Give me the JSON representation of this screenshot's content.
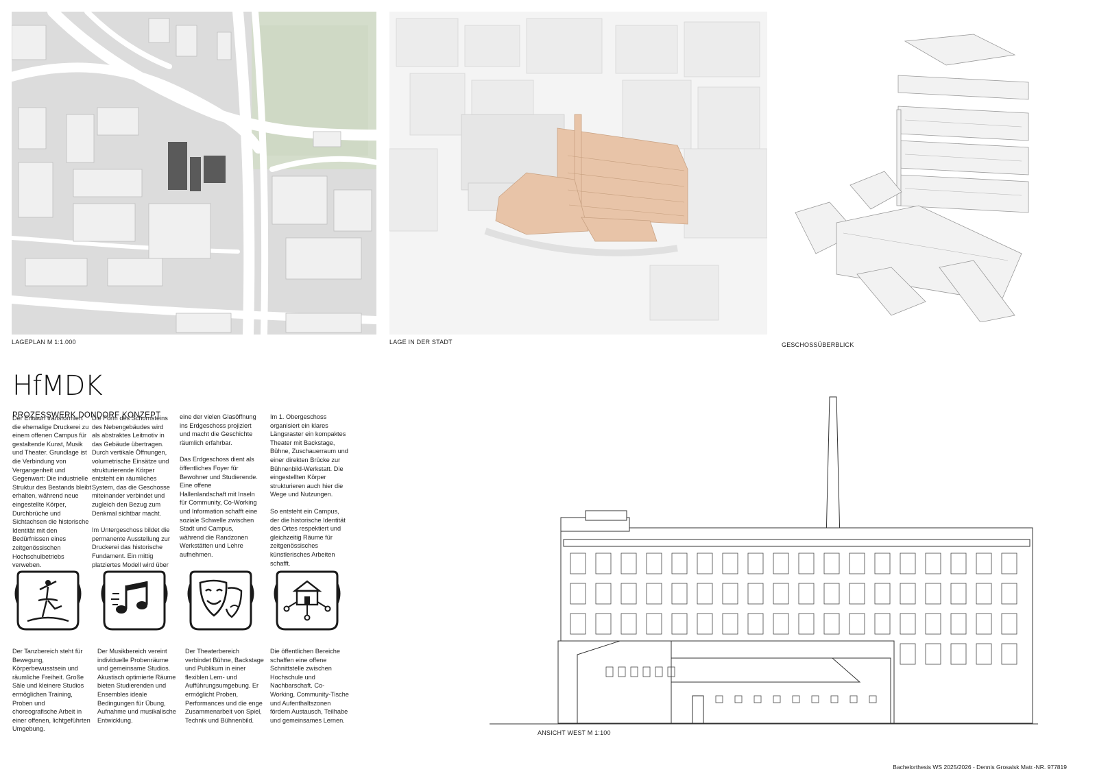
{
  "captions": {
    "lageplan": "LAGEPLAN M 1:1.000",
    "lage_stadt": "LAGE IN DER STADT",
    "geschoss": "GESCHOSSÜBERBLICK",
    "ansicht": "ANSICHT WEST M 1:100"
  },
  "logo": "HfMDK",
  "subtitle": "PROZESSWERK DONDORF KONZEPT",
  "text_columns": [
    [
      "Der Entwurf transformiert die ehemalige Druckerei zu einem offenen Campus für gestaltende Kunst, Musik und Theater. Grundlage ist die Verbindung von Vergangenheit und Gegenwart: Die industrielle Struktur des Bestands bleibt erhalten, während neue eingestellte Körper, Durchbrüche und Sichtachsen die historische Identität mit den Bedürfnissen eines zeitgenössischen Hochschulbetriebs verweben."
    ],
    [
      "Die Form des Schornsteins des Nebengebäudes wird als abstraktes Leitmotiv in das Gebäude übertragen. Durch vertikale Öffnungen, volumetrische Einsätze und strukturierende Körper entsteht ein räumliches System, das die Geschosse miteinander verbindet und zugleich den Bezug zum Denkmal sichtbar macht.",
      "Im Untergeschoss bildet die permanente Ausstellung zur Druckerei das historische Fundament. Ein mittig platziertes Modell wird über"
    ],
    [
      "eine der vielen Glasöffnung ins Erdgeschoss projiziert und macht die Geschichte räumlich erfahrbar.",
      "Das Erdgeschoss dient als öffentliches Foyer für Bewohner und Studierende. Eine offene Hallenlandschaft mit Inseln für Community, Co-Working und Information schafft eine soziale Schwelle zwischen Stadt und Campus, während die Randzonen Werkstätten und Lehre aufnehmen."
    ],
    [
      "Im 1. Obergeschoss organisiert ein klares Längsraster ein kompaktes Theater mit Backstage, Bühne, Zuschauerraum und einer direkten Brücke zur Bühnenbild-Werkstatt. Die eingestellten Körper strukturieren auch hier die Wege und Nutzungen.",
      "So entsteht ein Campus, der die historische Identität des Ortes respektiert und gleichzeitig Räume für zeitgenössisches künstlerisches Arbeiten schafft."
    ]
  ],
  "icons": [
    {
      "name": "dance-icon",
      "text": "Der Tanzbereich steht für Bewegung, Körperbewusstsein und räumliche Freiheit. Große Säle und kleinere Studios ermöglichen Training, Proben und choreografische Arbeit in einer offenen, lichtgeführten Umgebung."
    },
    {
      "name": "music-icon",
      "text": "Der Musikbereich vereint individuelle Probenräume und gemeinsame Studios. Akustisch optimierte Räume bieten Studierenden und Ensembles ideale Bedingungen für Übung, Aufnahme und musikalische Entwicklung."
    },
    {
      "name": "theater-icon",
      "text": "Der Theaterbereich verbindet Bühne, Backstage und Publikum in einer flexiblen Lern- und Aufführungsumgebung. Er ermöglicht Proben, Performances und die enge Zusammenarbeit von Spiel, Technik und Bühnenbild."
    },
    {
      "name": "public-icon",
      "text": "Die öffentlichen Bereiche schaffen eine offene Schnittstelle zwischen Hochschule und Nachbarschaft. Co-Working, Community-Tische und Aufenthaltszonen fördern Austausch, Teilhabe und gemeinsames Lernen."
    }
  ],
  "footer": "Bachelorthesis WS 2025/2026 - Dennis Grosalsk Matr.-NR. 977819",
  "colors": {
    "highlight": "#e8c4a8",
    "map_bg": "#dcdcdc",
    "park": "#d2dcc8",
    "building_dark": "#5a5a5a"
  }
}
